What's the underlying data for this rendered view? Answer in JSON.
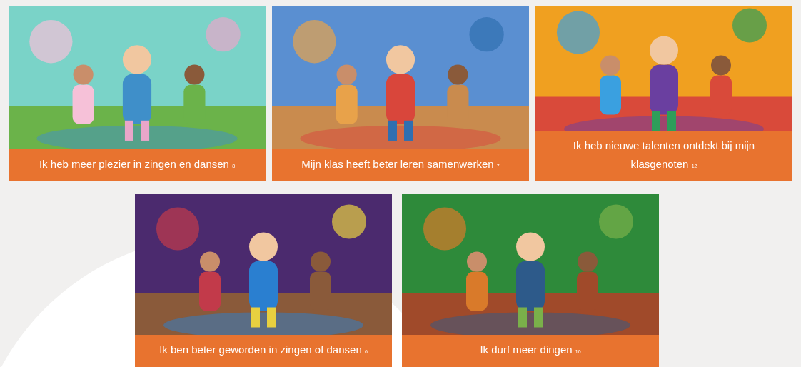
{
  "rows": [
    {
      "cards": [
        {
          "caption": "Ik heb meer plezier in zingen en dansen",
          "count": "8"
        },
        {
          "caption": "Mijn klas heeft beter leren samenwerken",
          "count": "7"
        },
        {
          "caption": "Ik heb nieuwe talenten ontdekt bij mijn klasgenoten",
          "count": "12"
        }
      ]
    },
    {
      "cards": [
        {
          "caption": "Ik ben beter geworden in zingen of dansen",
          "count": "6"
        },
        {
          "caption": "Ik durf meer dingen",
          "count": "10"
        }
      ]
    }
  ]
}
